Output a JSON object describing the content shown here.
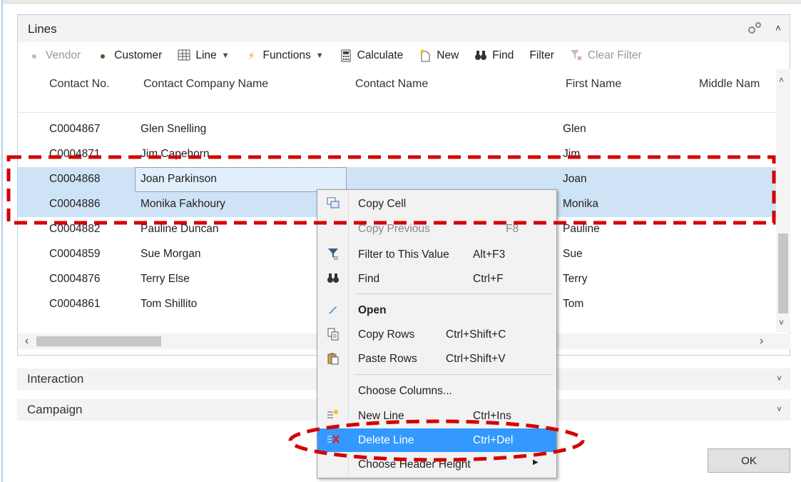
{
  "lines": {
    "title": "Lines",
    "toolbar": [
      {
        "id": "vendor",
        "label": "Vendor",
        "icon": "person-icon",
        "disabled": true
      },
      {
        "id": "customer",
        "label": "Customer",
        "icon": "person-icon"
      },
      {
        "id": "line",
        "label": "Line",
        "icon": "grid-icon",
        "dropdown": true
      },
      {
        "id": "functions",
        "label": "Functions",
        "icon": "lightning-icon",
        "dropdown": true
      },
      {
        "id": "calculate",
        "label": "Calculate",
        "icon": "calculator-icon"
      },
      {
        "id": "new",
        "label": "New",
        "icon": "new-document-icon"
      },
      {
        "id": "find",
        "label": "Find",
        "icon": "binoculars-icon"
      },
      {
        "id": "filter",
        "label": "Filter"
      },
      {
        "id": "clear-filter",
        "label": "Clear Filter",
        "icon": "clear-filter-icon",
        "disabled": true
      }
    ],
    "columns": [
      "Contact No.",
      "Contact Company Name",
      "Contact Name",
      "First Name",
      "Middle Nam"
    ],
    "rows": [
      {
        "no": "C0004867",
        "company": "Glen Snelling",
        "contact": "",
        "first": "Glen"
      },
      {
        "no": "C0004871",
        "company": "Jim Capehorn",
        "contact": "",
        "first": "Jim"
      },
      {
        "no": "C0004868",
        "company": "Joan Parkinson",
        "contact": "",
        "first": "Joan"
      },
      {
        "no": "C0004886",
        "company": "Monika Fakhoury",
        "contact": "",
        "first": "Monika"
      },
      {
        "no": "C0004882",
        "company": "Pauline Duncan",
        "contact": "",
        "first": "Pauline"
      },
      {
        "no": "C0004859",
        "company": "Sue Morgan",
        "contact": "",
        "first": "Sue"
      },
      {
        "no": "C0004876",
        "company": "Terry Else",
        "contact": "",
        "first": "Terry"
      },
      {
        "no": "C0004861",
        "company": "Tom Shillito",
        "contact": "",
        "first": "Tom"
      }
    ]
  },
  "interaction": {
    "title": "Interaction"
  },
  "campaign": {
    "title": "Campaign"
  },
  "ok_label": "OK",
  "context_menu": {
    "items": [
      {
        "label": "Copy Cell",
        "shortcut": "",
        "icon": "copy-cell-icon"
      },
      {
        "label": "Copy Previous",
        "shortcut": "F8",
        "icon": "",
        "disabled": true
      },
      {
        "label": "Filter to This Value",
        "shortcut": "Alt+F3",
        "icon": "filter-icon"
      },
      {
        "label": "Find",
        "shortcut": "Ctrl+F",
        "icon": "binoculars-icon"
      },
      {
        "label": "Open",
        "shortcut": "",
        "icon": "pencil-icon",
        "bold": true
      },
      {
        "label": "Copy Rows",
        "shortcut": "Ctrl+Shift+C",
        "icon": "copy-rows-icon"
      },
      {
        "label": "Paste Rows",
        "shortcut": "Ctrl+Shift+V",
        "icon": "paste-rows-icon"
      },
      {
        "label": "Choose Columns...",
        "shortcut": "",
        "icon": ""
      },
      {
        "label": "New Line",
        "shortcut": "Ctrl+Ins",
        "icon": "new-line-icon"
      },
      {
        "label": "Delete Line",
        "shortcut": "Ctrl+Del",
        "icon": "delete-line-icon",
        "highlighted": true
      },
      {
        "label": "Choose Header Height",
        "shortcut": "",
        "icon": "",
        "submenu": true
      }
    ]
  },
  "colors": {
    "selection": "#cfe3f7",
    "menu_highlight": "#3399ff",
    "annotation_red": "#d40000"
  }
}
